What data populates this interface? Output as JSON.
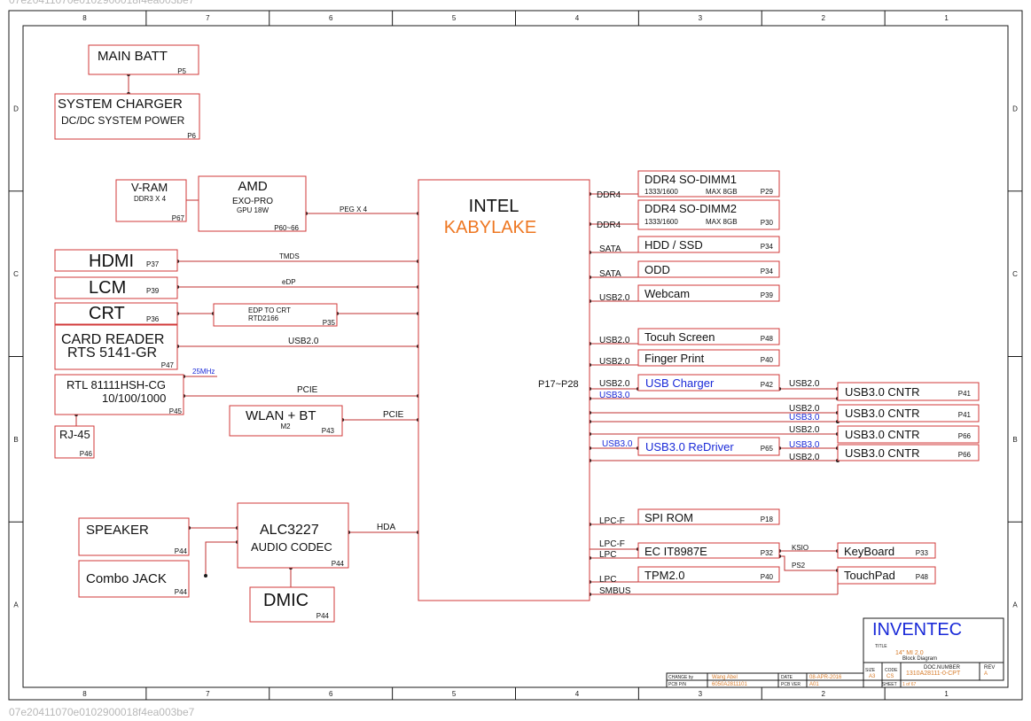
{
  "page_id_text": "07e20411070e0102900018f4ea003be7",
  "border_cols": [
    "8",
    "7",
    "6",
    "5",
    "4",
    "3",
    "2",
    "1"
  ],
  "border_rows": [
    "D",
    "C",
    "B",
    "A"
  ],
  "colors": {
    "frame": "#1a1a1a",
    "block": "#d23a3a",
    "wire": "#c03030",
    "accent": "#ee7722",
    "blue": "#1a2ad8",
    "title_orange": "#d67a28"
  },
  "cpu": {
    "line1": "INTEL",
    "line2": "KABYLAKE",
    "pages": "P17~P28"
  },
  "blocks": {
    "main_batt": {
      "label": "MAIN BATT",
      "page": "P5"
    },
    "charger": {
      "label": "SYSTEM CHARGER",
      "sub": "DC/DC SYSTEM POWER",
      "page": "P6"
    },
    "vram": {
      "label": "V-RAM",
      "sub": "DDR3 X 4",
      "page": "P67"
    },
    "amd": {
      "label": "AMD",
      "sub": "EXO-PRO",
      "sub2": "GPU 18W",
      "page": "P60~66"
    },
    "hdmi": {
      "label": "HDMI",
      "page": "P37"
    },
    "lcm": {
      "label": "LCM",
      "page": "P39"
    },
    "crt": {
      "label": "CRT",
      "page": "P36"
    },
    "edp_crt": {
      "label": "EDP TO CRT",
      "sub": "RTD2166",
      "page": "P35"
    },
    "card_reader": {
      "label": "CARD READER",
      "sub": "RTS 5141-GR",
      "page": "P47"
    },
    "rtl": {
      "label": "RTL 81111HSH-CG",
      "sub": "10/100/1000",
      "page": "P45"
    },
    "rj45": {
      "label": "RJ-45",
      "page": "P46"
    },
    "wlan": {
      "label": "WLAN + BT",
      "sub": "M2",
      "page": "P43"
    },
    "speaker": {
      "label": "SPEAKER",
      "page": "P44"
    },
    "combo_jack": {
      "label": "Combo JACK",
      "page": "P44"
    },
    "alc": {
      "label": "ALC3227",
      "sub": "AUDIO CODEC",
      "page": "P44"
    },
    "dmic": {
      "label": "DMIC",
      "page": "P44"
    },
    "ddr1": {
      "label": "DDR4 SO-DIMM1",
      "sub": "1333/1600",
      "sub2": "MAX  8GB",
      "page": "P29"
    },
    "ddr2": {
      "label": "DDR4 SO-DIMM2",
      "sub": "1333/1600",
      "sub2": "MAX  8GB",
      "page": "P30"
    },
    "hdd": {
      "label": "HDD / SSD",
      "page": "P34"
    },
    "odd": {
      "label": "ODD",
      "page": "P34"
    },
    "webcam": {
      "label": "Webcam",
      "page": "P39"
    },
    "touch": {
      "label": "Tocuh Screen",
      "page": "P48"
    },
    "finger": {
      "label": "Finger Print",
      "page": "P40"
    },
    "usbchg": {
      "label": "USB Charger",
      "page": "P42"
    },
    "redriver": {
      "label": "USB3.0 ReDriver",
      "page": "P65"
    },
    "usb30_1": {
      "label": "USB3.0 CNTR",
      "page": "P41"
    },
    "usb30_2": {
      "label": "USB3.0 CNTR",
      "page": "P41"
    },
    "usb30_3": {
      "label": "USB3.0 CNTR",
      "page": "P66"
    },
    "usb30_4": {
      "label": "USB3.0 CNTR",
      "page": "P66"
    },
    "spirom": {
      "label": "SPI ROM",
      "page": "P18"
    },
    "ec": {
      "label": "EC IT8987E",
      "page": "P32"
    },
    "tpm": {
      "label": "TPM2.0",
      "page": "P40"
    },
    "keyboard": {
      "label": "KeyBoard",
      "page": "P33"
    },
    "touchpad": {
      "label": "TouchPad",
      "page": "P48"
    }
  },
  "signals": {
    "peg": "PEG X 4",
    "tmds": "TMDS",
    "edp": "eDP",
    "usb20": "USB2.0",
    "pcie": "PCIE",
    "mhz": "25MHz",
    "hda": "HDA",
    "ddr4": "DDR4",
    "sata": "SATA",
    "usb30": "USB3.0",
    "lpcf": "LPC-F",
    "lpc": "LPC",
    "smbus": "SMBUS",
    "ksio": "KSIO",
    "ps2": "PS2"
  },
  "title_block": {
    "company": "INVENTEC",
    "title_lbl": "TITLE",
    "title": "14\" MI 2.0",
    "title2": "Block   Diagram",
    "size_lbl": "SIZE",
    "size": "A3",
    "code_lbl": "CODE",
    "code": "CS",
    "docnum_lbl": "DOC.NUMBER",
    "docnum": "1310A28111-0-CPT",
    "rev_lbl": "REV",
    "rev": "A",
    "sheet_lbl": "SHEET",
    "sheet_val": "1    of    67",
    "change_lbl": "CHANGE by",
    "change": "Wang Abel",
    "pcbpn_lbl": "PCB P/N",
    "pcbpn": "6050A2811101",
    "date_lbl": "DATE",
    "date": "08-APR-2016",
    "pcbver_lbl": "PCB VER",
    "pcbver": "A01"
  }
}
